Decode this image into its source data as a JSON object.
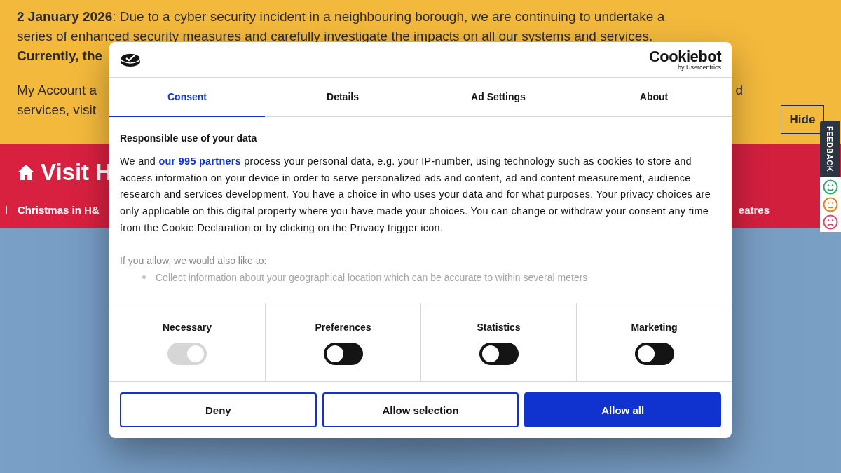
{
  "notice": {
    "lines": [
      {
        "bold": "2 January 2026",
        "text": ": Due to a cyber security incident in a neighbouring borough, we are continuing to undertake a"
      },
      {
        "text": "series of enhanced security measures and carefully investigate the impacts on all our systems and services."
      },
      {
        "bold": "Currently, the"
      },
      {
        "text": "My Account a",
        "right": "d"
      },
      {
        "text": "services, visit"
      }
    ],
    "hide_button": "Hide"
  },
  "header": {
    "title": "Visit H",
    "nav": [
      {
        "label": "Christmas in H&"
      },
      {
        "label": "eatres"
      }
    ]
  },
  "feedback": {
    "label": "FEEDBACK"
  },
  "cookie_dialog": {
    "brand": "Cookiebot",
    "brand_sub": "by Usercentrics",
    "tabs": [
      {
        "label": "Consent",
        "selected": true
      },
      {
        "label": "Details",
        "selected": false
      },
      {
        "label": "Ad Settings",
        "selected": false
      },
      {
        "label": "About",
        "selected": false
      }
    ],
    "heading": "Responsible use of your data",
    "intro_before": "We and ",
    "intro_link": "our 995 partners",
    "intro_after": " process your personal data, e.g. your IP-number, using technology such as cookies to store and access information on your device in order to serve personalized ads and content, ad and content measurement, audience research and services development. You have a choice in who uses your data and for what purposes. Your privacy choices are only applicable on this digital property where you have made your choices. You can change or withdraw your consent any time from the Cookie Declaration or by clicking on the Privacy trigger icon.",
    "also_title": "If you allow, we would also like to:",
    "also_items": [
      "Collect information about your geographical location which can be accurate to within several meters"
    ],
    "categories": [
      {
        "label": "Necessary",
        "checked": true,
        "disabled": true
      },
      {
        "label": "Preferences",
        "checked": false,
        "disabled": false
      },
      {
        "label": "Statistics",
        "checked": false,
        "disabled": false
      },
      {
        "label": "Marketing",
        "checked": false,
        "disabled": false
      }
    ],
    "buttons": [
      {
        "label": "Deny",
        "kind": "outline"
      },
      {
        "label": "Allow selection",
        "kind": "outline"
      },
      {
        "label": "Allow all",
        "kind": "primary"
      }
    ]
  }
}
